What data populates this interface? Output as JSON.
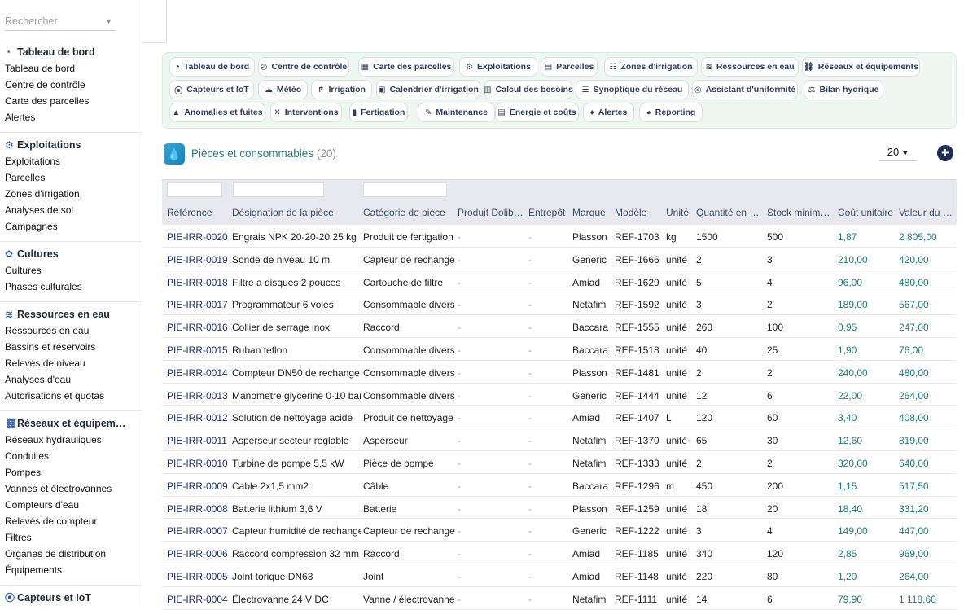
{
  "search": {
    "placeholder": "Rechercher"
  },
  "sidebar": {
    "groups": [
      {
        "title": "Tableau de bord",
        "icon": "dashboard-icon",
        "items": [
          "Tableau de bord",
          "Centre de contrôle",
          "Carte des parcelles",
          "Alertes"
        ]
      },
      {
        "title": "Exploitations",
        "icon": "tractor-icon",
        "items": [
          "Exploitations",
          "Parcelles",
          "Zones d'irrigation",
          "Analyses de sol",
          "Campagnes"
        ]
      },
      {
        "title": "Cultures",
        "icon": "sprout-icon",
        "items": [
          "Cultures",
          "Phases culturales"
        ]
      },
      {
        "title": "Ressources en eau",
        "icon": "water-icon",
        "items": [
          "Ressources en eau",
          "Bassins et réservoirs",
          "Relevés de niveau",
          "Analyses d'eau",
          "Autorisations et quotas"
        ]
      },
      {
        "title": "Réseaux et équipem…",
        "icon": "network-icon",
        "items": [
          "Réseaux hydrauliques",
          "Conduites",
          "Pompes",
          "Vannes et électrovannes",
          "Compteurs d'eau",
          "Relevés de compteur",
          "Filtres",
          "Organes de distribution",
          "Équipements"
        ]
      },
      {
        "title": "Capteurs et IoT",
        "icon": "sensor-icon",
        "items": []
      }
    ]
  },
  "tabs": [
    {
      "label": "Tableau de bord",
      "icon": "dashboard-icon"
    },
    {
      "label": "Centre de contrôle",
      "icon": "gauge-icon"
    },
    {
      "label": "Carte des parcelles",
      "icon": "map-icon"
    },
    {
      "label": "Exploitations",
      "icon": "tractor-icon"
    },
    {
      "label": "Parcelles",
      "icon": "parcel-icon"
    },
    {
      "label": "Zones d'irrigation",
      "icon": "zones-icon"
    },
    {
      "label": "Ressources en eau",
      "icon": "water-icon"
    },
    {
      "label": "Réseaux et équipements",
      "icon": "network-icon"
    },
    {
      "label": "Capteurs et IoT",
      "icon": "sensor-icon"
    },
    {
      "label": "Météo",
      "icon": "weather-icon"
    },
    {
      "label": "Irrigation",
      "icon": "irrigation-icon"
    },
    {
      "label": "Calendrier d'irrigation",
      "icon": "calendar-icon"
    },
    {
      "label": "Calcul des besoins",
      "icon": "calculator-icon"
    },
    {
      "label": "Synoptique du réseau",
      "icon": "synoptic-icon"
    },
    {
      "label": "Assistant d'uniformité",
      "icon": "target-icon"
    },
    {
      "label": "Bilan hydrique",
      "icon": "balance-icon"
    },
    {
      "label": "Anomalies et fuites",
      "icon": "warning-icon"
    },
    {
      "label": "Interventions",
      "icon": "tools-icon"
    },
    {
      "label": "Fertigation",
      "icon": "fertigation-icon"
    },
    {
      "label": "Maintenance",
      "icon": "wrench-icon"
    },
    {
      "label": "Énergie et coûts",
      "icon": "energy-icon"
    },
    {
      "label": "Alertes",
      "icon": "bell-icon"
    },
    {
      "label": "Reporting",
      "icon": "chart-icon"
    }
  ],
  "list": {
    "title": "Pièces et consommables",
    "count": "(20)",
    "page_size": "20",
    "add_label": "+"
  },
  "columns": [
    "Référence",
    "Désignation de la pièce",
    "Catégorie de pièce",
    "Produit Dolib…",
    "Entrepôt",
    "Marque",
    "Modèle",
    "Unité",
    "Quantité en …",
    "Stock minim…",
    "Coût unitaire",
    "Valeur du st…"
  ],
  "rows": [
    [
      "PIE-IRR-0020",
      "Engrais NPK 20-20-20 25 kg",
      "Produit de fertigation",
      "-",
      "-",
      "Plasson",
      "REF-1703",
      "kg",
      "1500",
      "500",
      "1,87",
      "2 805,00"
    ],
    [
      "PIE-IRR-0019",
      "Sonde de niveau 10 m",
      "Capteur de rechange",
      "-",
      "-",
      "Generic",
      "REF-1666",
      "unité",
      "2",
      "3",
      "210,00",
      "420,00"
    ],
    [
      "PIE-IRR-0018",
      "Filtre a disques 2 pouces",
      "Cartouche de filtre",
      "-",
      "-",
      "Amiad",
      "REF-1629",
      "unité",
      "5",
      "4",
      "96,00",
      "480,00"
    ],
    [
      "PIE-IRR-0017",
      "Programmateur 6 voies",
      "Consommable divers",
      "-",
      "-",
      "Netafim",
      "REF-1592",
      "unité",
      "3",
      "2",
      "189,00",
      "567,00"
    ],
    [
      "PIE-IRR-0016",
      "Collier de serrage inox",
      "Raccord",
      "-",
      "-",
      "Baccara",
      "REF-1555",
      "unité",
      "260",
      "100",
      "0,95",
      "247,00"
    ],
    [
      "PIE-IRR-0015",
      "Ruban teflon",
      "Consommable divers",
      "-",
      "-",
      "Baccara",
      "REF-1518",
      "unité",
      "40",
      "25",
      "1,90",
      "76,00"
    ],
    [
      "PIE-IRR-0014",
      "Compteur DN50 de rechange",
      "Consommable divers",
      "-",
      "-",
      "Plasson",
      "REF-1481",
      "unité",
      "2",
      "2",
      "240,00",
      "480,00"
    ],
    [
      "PIE-IRR-0013",
      "Manometre glycerine 0-10 bar",
      "Consommable divers",
      "-",
      "-",
      "Generic",
      "REF-1444",
      "unité",
      "12",
      "6",
      "22,00",
      "264,00"
    ],
    [
      "PIE-IRR-0012",
      "Solution de nettoyage acide",
      "Produit de nettoyage",
      "-",
      "-",
      "Amiad",
      "REF-1407",
      "L",
      "120",
      "60",
      "3,40",
      "408,00"
    ],
    [
      "PIE-IRR-0011",
      "Asperseur secteur reglable",
      "Asperseur",
      "-",
      "-",
      "Netafim",
      "REF-1370",
      "unité",
      "65",
      "30",
      "12,60",
      "819,00"
    ],
    [
      "PIE-IRR-0010",
      "Turbine de pompe 5,5 kW",
      "Pièce de pompe",
      "-",
      "-",
      "Netafim",
      "REF-1333",
      "unité",
      "2",
      "2",
      "320,00",
      "640,00"
    ],
    [
      "PIE-IRR-0009",
      "Cable 2x1,5 mm2",
      "Câble",
      "-",
      "-",
      "Baccara",
      "REF-1296",
      "m",
      "450",
      "200",
      "1,15",
      "517,50"
    ],
    [
      "PIE-IRR-0008",
      "Batterie lithium 3,6 V",
      "Batterie",
      "-",
      "-",
      "Plasson",
      "REF-1259",
      "unité",
      "18",
      "20",
      "18,40",
      "331,20"
    ],
    [
      "PIE-IRR-0007",
      "Capteur humidité de rechange",
      "Capteur de rechange",
      "-",
      "-",
      "Generic",
      "REF-1222",
      "unité",
      "3",
      "4",
      "149,00",
      "447,00"
    ],
    [
      "PIE-IRR-0006",
      "Raccord compression 32 mm",
      "Raccord",
      "-",
      "-",
      "Amiad",
      "REF-1185",
      "unité",
      "340",
      "120",
      "2,85",
      "969,00"
    ],
    [
      "PIE-IRR-0005",
      "Joint torique DN63",
      "Joint",
      "-",
      "-",
      "Amiad",
      "REF-1148",
      "unité",
      "220",
      "80",
      "1,20",
      "264,00"
    ],
    [
      "PIE-IRR-0004",
      "Électrovanne 24 V DC",
      "Vanne / électrovanne",
      "-",
      "-",
      "Netafim",
      "REF-1111",
      "unité",
      "14",
      "6",
      "79,90",
      "1 118,60"
    ]
  ]
}
